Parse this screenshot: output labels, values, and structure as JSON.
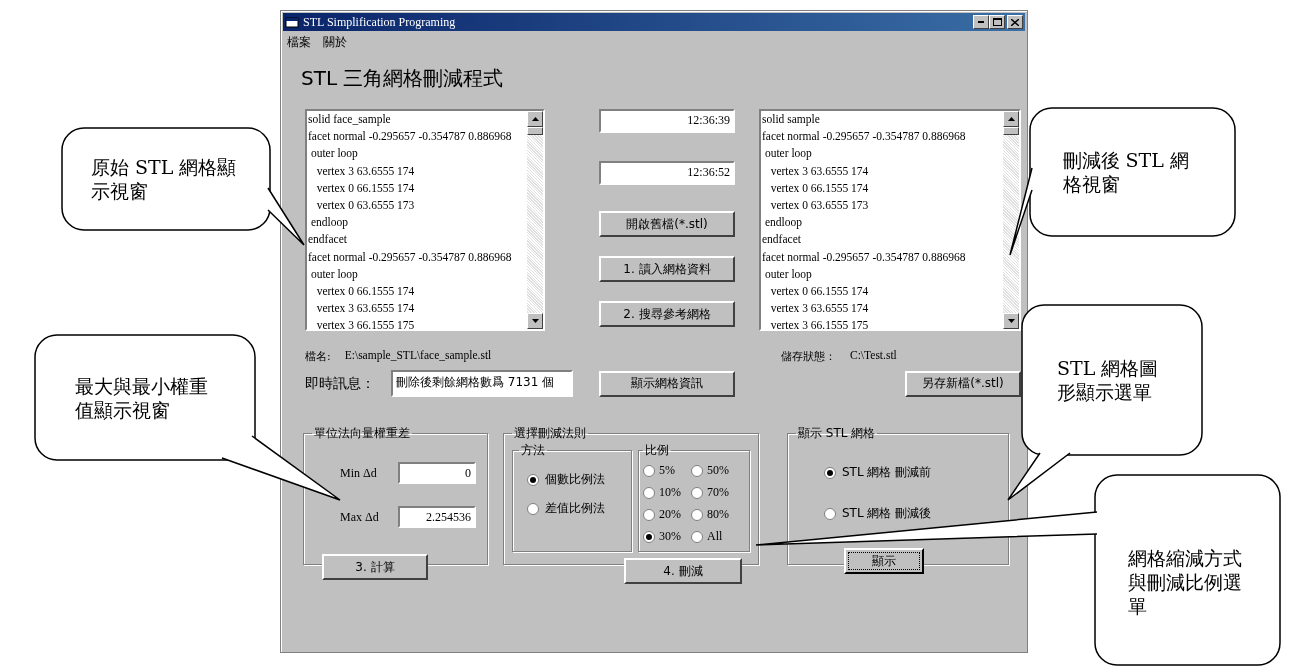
{
  "window": {
    "title": "STL Simplification Programing"
  },
  "menu": [
    {
      "label": "檔案"
    },
    {
      "label": "關於"
    }
  ],
  "heading": "STL 三角網格刪減程式",
  "source_listing": {
    "lines": [
      "solid face_sample",
      "facet normal -0.295657 -0.354787 0.886968",
      " outer loop",
      "   vertex 3 63.6555 174",
      "   vertex 0 66.1555 174",
      "   vertex 0 63.6555 173",
      " endloop",
      "endfacet",
      "facet normal -0.295657 -0.354787 0.886968",
      " outer loop",
      "   vertex 0 66.1555 174",
      "   vertex 3 63.6555 174",
      "   vertex 3 66.1555 175"
    ]
  },
  "timers": [
    "12:36:39",
    "12:36:52"
  ],
  "actions": [
    "開啟舊檔(*.stl)",
    "1. 讀入網格資料",
    "2. 搜尋參考網格"
  ],
  "result_listing": {
    "lines": [
      "solid sample",
      "facet normal -0.295657 -0.354787 0.886968",
      " outer loop",
      "   vertex 3 63.6555 174",
      "   vertex 0 66.1555 174",
      "   vertex 0 63.6555 173",
      " endloop",
      "endfacet",
      "facet normal -0.295657 -0.354787 0.886968",
      " outer loop",
      "   vertex 0 66.1555 174",
      "   vertex 3 63.6555 174",
      "   vertex 3 66.1555 175"
    ]
  },
  "file_name": {
    "label": "檔名:",
    "value": "E:\\sample_STL\\face_sample.stl"
  },
  "save_status": {
    "label": "儲存狀態：",
    "value": "C:\\Test.stl"
  },
  "message": {
    "label": "即時訊息：",
    "value": "刪除後剩餘網格數爲 7131 個"
  },
  "info_button": "顯示網格資訊",
  "save_button": "另存新檔(*.stl)",
  "weight_group": {
    "title": "單位法向量權重差",
    "fields": [
      {
        "label": "Min Δd",
        "value": "0"
      },
      {
        "label": "Max Δd",
        "value": "2.254536"
      }
    ],
    "button": "3. 計算"
  },
  "rule_group": {
    "title": "選擇刪減法則",
    "method": {
      "title": "方法",
      "options": [
        {
          "label": "個數比例法",
          "selected": true
        },
        {
          "label": "差值比例法",
          "selected": false
        }
      ]
    },
    "ratio": {
      "title": "比例",
      "options": [
        {
          "label": "5%",
          "selected": false
        },
        {
          "label": "50%",
          "selected": false
        },
        {
          "label": "10%",
          "selected": false
        },
        {
          "label": "70%",
          "selected": false
        },
        {
          "label": "20%",
          "selected": false
        },
        {
          "label": "80%",
          "selected": false
        },
        {
          "label": "30%",
          "selected": true
        },
        {
          "label": "All",
          "selected": false
        }
      ]
    },
    "button": "4. 刪減"
  },
  "display_group": {
    "title": "顯示 STL 網格",
    "options": [
      {
        "label": "STL 網格 刪減前",
        "selected": true
      },
      {
        "label": "STL 網格 刪減後",
        "selected": false
      }
    ],
    "button": "顯示"
  },
  "callouts": [
    {
      "text": "原始 STL 網格顯示視窗"
    },
    {
      "text": "刪減後 STL 網格視窗"
    },
    {
      "text": "最大與最小權重值顯示視窗"
    },
    {
      "text": "STL 網格圖形顯示選單"
    },
    {
      "text": "網格縮減方式與刪減比例選單"
    }
  ]
}
